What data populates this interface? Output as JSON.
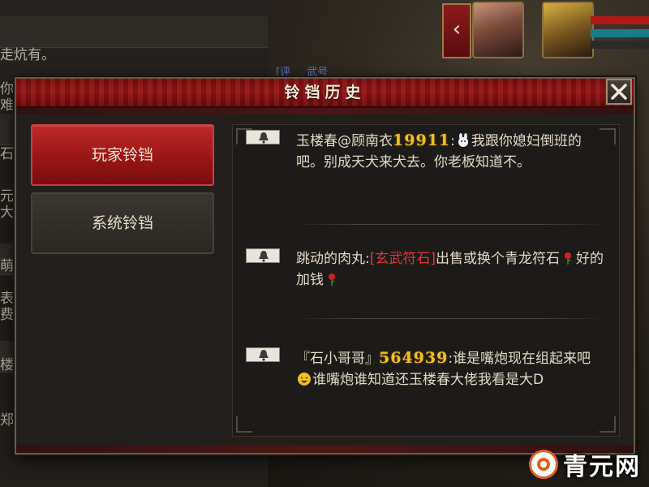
{
  "dialog": {
    "title": "铃铛历史",
    "close_label": "×"
  },
  "tabs": [
    {
      "label": "玩家铃铛",
      "active": true
    },
    {
      "label": "系统铃铛",
      "active": false
    }
  ],
  "messages": [
    {
      "icon": "bell-icon",
      "sender": "玉楼春@顾南衣",
      "number": "19911",
      "after_number": ":",
      "emoji": "rabbit-emoji",
      "text": "我跟你媳妇倒班的吧。别成天犬来犬去。你老板知道不。"
    },
    {
      "icon": "bell-icon",
      "sender": "跳动的肉丸",
      "after_sender": ":",
      "item": "[玄武符石]",
      "text_1": "出售或换个青龙符石",
      "emoji_1": "rose-emoji",
      "text_2": "好的加钱",
      "emoji_2": "rose-emoji"
    },
    {
      "icon": "bell-icon",
      "sender": "『石小哥哥』",
      "number": "564939",
      "after_number": ":",
      "text_1": "谁是嘴炮现在组起来吧",
      "emoji": "laughing-emoji",
      "text_2": "谁嘴炮谁知道还玉楼春大佬我看是大D"
    }
  ],
  "background": {
    "left_fragments": [
      "走炕有。",
      "你",
      "难",
      "石",
      "元",
      "大",
      "萌",
      "表",
      "费",
      "楼",
      "郑"
    ],
    "channel_fragment": "[评",
    "channel_tail": "武号"
  },
  "watermark": {
    "text": "青元网"
  },
  "colors": {
    "accent_red": "#9a1414",
    "number_gold": "#f0c020",
    "item_red": "#e03838",
    "text_main": "#e2d8c6"
  }
}
